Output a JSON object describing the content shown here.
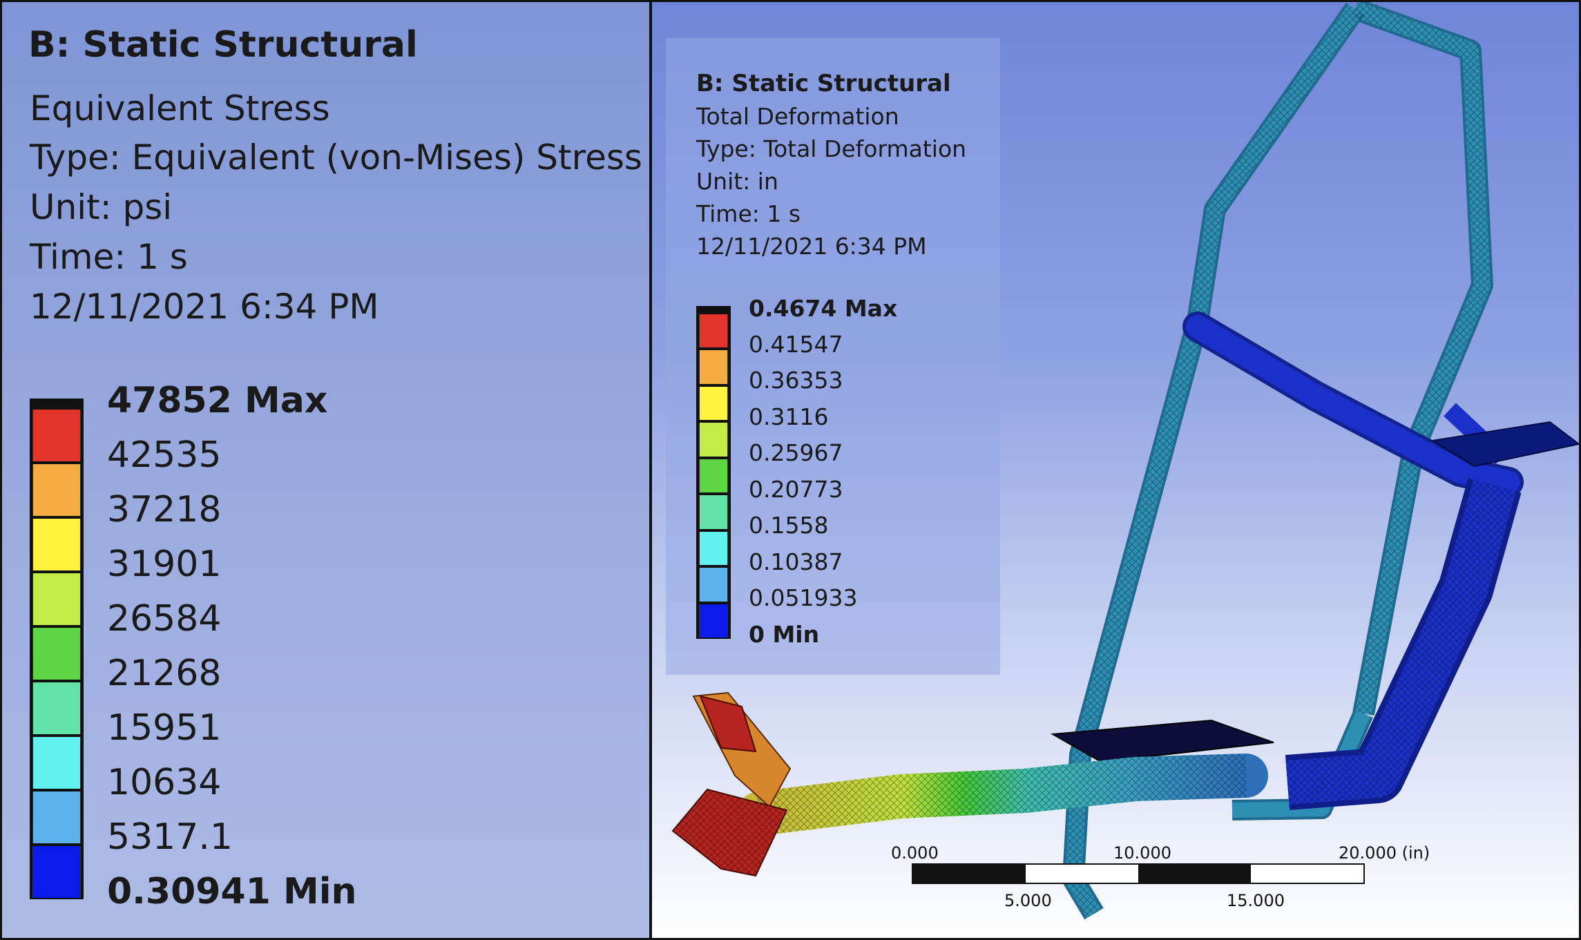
{
  "stress_panel": {
    "title": "B: Static Structural",
    "result_name": "Equivalent Stress",
    "type_line": "Type: Equivalent (von-Mises) Stress",
    "unit_line": "Unit: psi",
    "time_line": "Time: 1 s",
    "date_line": "12/11/2021 6:34 PM",
    "legend_labels": [
      "47852 Max",
      "42535",
      "37218",
      "31901",
      "26584",
      "21268",
      "15951",
      "10634",
      "5317.1",
      "0.30941 Min"
    ]
  },
  "deformation_panel": {
    "title": "B: Static Structural",
    "result_name": "Total Deformation",
    "type_line": "Type: Total Deformation",
    "unit_line": "Unit: in",
    "time_line": "Time: 1 s",
    "date_line": "12/11/2021 6:34 PM",
    "legend_labels": [
      "0.4674 Max",
      "0.41547",
      "0.36353",
      "0.3116",
      "0.25967",
      "0.20773",
      "0.1558",
      "0.10387",
      "0.051933",
      "0 Min"
    ],
    "scale_bar": {
      "top_labels": [
        "0.000",
        "10.000",
        "20.000 (in)"
      ],
      "bottom_labels": [
        "5.000",
        "15.000"
      ]
    }
  },
  "legend_colors": [
    "#e3342b",
    "#f4ac43",
    "#fdf33f",
    "#c4ec48",
    "#5dd545",
    "#63e2a9",
    "#63f0f0",
    "#5db1ec",
    "#0a1ae8"
  ],
  "colors": {
    "frame_tube": "#2e8fb5",
    "blue_tube": "#1a30c8",
    "background_top": "#6f86d8",
    "background_bottom": "#ffffff"
  }
}
